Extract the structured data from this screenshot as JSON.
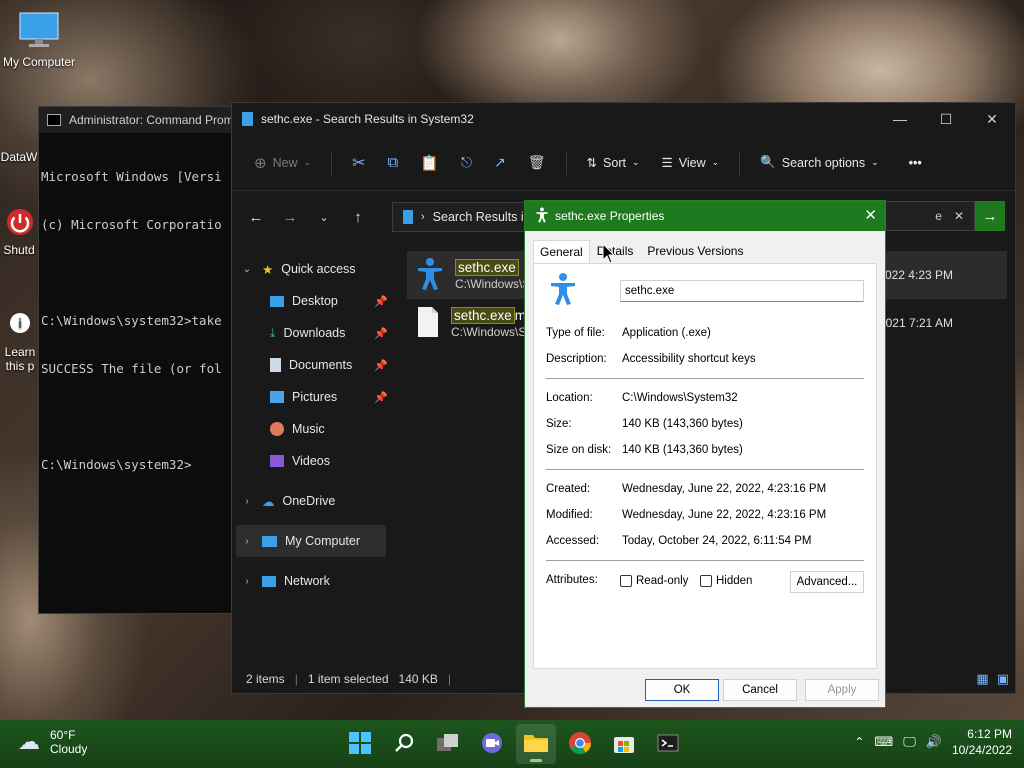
{
  "desktop": {
    "icons": [
      {
        "label": "My Computer"
      },
      {
        "label": "DataW"
      },
      {
        "label": "Shutd"
      },
      {
        "label": "Learn"
      },
      {
        "label": "this p"
      }
    ]
  },
  "cmd": {
    "title": "Administrator: Command Prom",
    "lines": [
      "Microsoft Windows [Versi",
      "(c) Microsoft Corporatio",
      "",
      "C:\\Windows\\system32>take",
      "SUCCESS The file (or fol",
      "",
      "C:\\Windows\\system32>"
    ]
  },
  "explorer": {
    "title": "sethc.exe - Search Results in System32",
    "toolbar": {
      "new": "New",
      "sort": "Sort",
      "view": "View",
      "search_options": "Search options"
    },
    "address": "Search Results in Syst",
    "search_text": "e",
    "nav": {
      "quick_access": "Quick access",
      "desktop": "Desktop",
      "downloads": "Downloads",
      "documents": "Documents",
      "pictures": "Pictures",
      "music": "Music",
      "videos": "Videos",
      "onedrive": "OneDrive",
      "my_computer": "My Computer",
      "network": "Network"
    },
    "files": [
      {
        "name": "sethc.exe",
        "path": "C:\\Windows\\S",
        "date": "22/2022 4:23 PM"
      },
      {
        "name": "sethc.exe",
        "suffix": "m",
        "path": "C:\\Windows\\S",
        "date": "5/2021 7:21 AM"
      }
    ],
    "status": {
      "items": "2 items",
      "selected": "1 item selected",
      "size": "140 KB"
    }
  },
  "properties": {
    "title": "sethc.exe Properties",
    "tabs": [
      "General",
      "Details",
      "Previous Versions"
    ],
    "filename": "sethc.exe",
    "type_label": "Type of file:",
    "type_value": "Application (.exe)",
    "desc_label": "Description:",
    "desc_value": "Accessibility shortcut keys",
    "location_label": "Location:",
    "location_value": "C:\\Windows\\System32",
    "size_label": "Size:",
    "size_value": "140 KB (143,360 bytes)",
    "sizedisk_label": "Size on disk:",
    "sizedisk_value": "140 KB (143,360 bytes)",
    "created_label": "Created:",
    "created_value": "Wednesday, June 22, 2022, 4:23:16 PM",
    "modified_label": "Modified:",
    "modified_value": "Wednesday, June 22, 2022, 4:23:16 PM",
    "accessed_label": "Accessed:",
    "accessed_value": "Today, October 24, 2022, 6:11:54 PM",
    "attributes_label": "Attributes:",
    "readonly": "Read-only",
    "hidden": "Hidden",
    "advanced": "Advanced...",
    "ok": "OK",
    "cancel": "Cancel",
    "apply": "Apply"
  },
  "taskbar": {
    "temp": "60°F",
    "condition": "Cloudy",
    "time": "6:12 PM",
    "date": "10/24/2022"
  },
  "colors": {
    "accent": "#1e7a1e",
    "taskbar": "#1a4a1a",
    "highlight": "#4a4a14"
  }
}
